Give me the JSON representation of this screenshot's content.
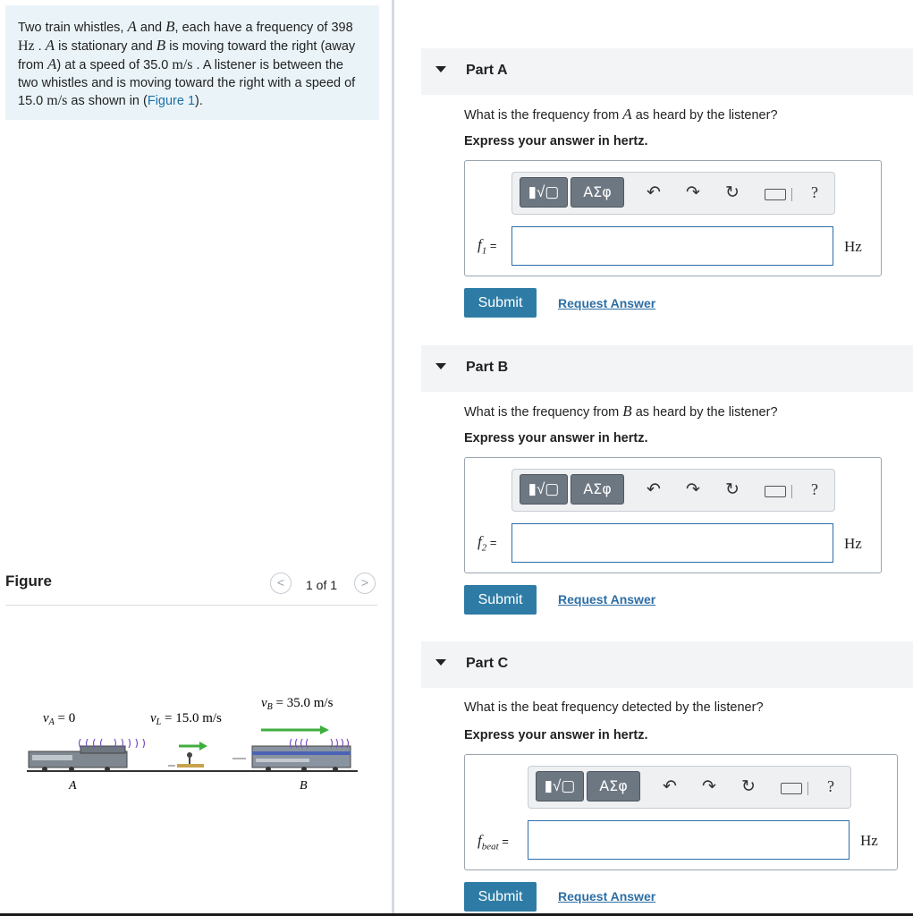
{
  "problem": {
    "seg1": "Two train whistles, ",
    "A": "A",
    "seg2": " and ",
    "B": "B",
    "seg3": ", each have a frequency of 398 ",
    "hz": "Hz",
    "seg4": " . ",
    "seg5": " is stationary and ",
    "seg6": " is moving toward the right (away from ",
    "seg7": ") at a speed of 35.0 ",
    "ms": "m/s",
    "seg8": " . A listener is between the two whistles and is moving toward the right with a speed of 15.0 ",
    "seg9": " as shown in (",
    "figure_link": "Figure 1",
    "seg10": ")."
  },
  "figure": {
    "title": "Figure",
    "pager": "1 of 1",
    "prev": "<",
    "next": ">",
    "labels": {
      "va": "v",
      "va_sub": "A",
      "va_val": " = 0",
      "vl": "v",
      "vl_sub": "L",
      "vl_val": " = 15.0 m/s",
      "vb": "v",
      "vb_sub": "B",
      "vb_val": " = 35.0 m/s",
      "a": "A",
      "b": "B"
    }
  },
  "parts": [
    {
      "title": "Part A",
      "question_pre": "What is the frequency from ",
      "question_var": "A",
      "question_post": " as heard by the listener?",
      "instruction": "Express your answer in hertz.",
      "var": "f",
      "var_sub": "1",
      "eq": " =",
      "unit": "Hz",
      "submit": "Submit",
      "request": "Request Answer"
    },
    {
      "title": "Part B",
      "question_pre": "What is the frequency from ",
      "question_var": "B",
      "question_post": " as heard by the listener?",
      "instruction": "Express your answer in hertz.",
      "var": "f",
      "var_sub": "2",
      "eq": " =",
      "unit": "Hz",
      "submit": "Submit",
      "request": "Request Answer"
    },
    {
      "title": "Part C",
      "question_pre": "What is the beat frequency detected by the listener?",
      "question_var": "",
      "question_post": "",
      "instruction": "Express your answer in hertz.",
      "var": "f",
      "var_sub": "beat",
      "eq": " =",
      "unit": "Hz",
      "submit": "Submit",
      "request": "Request Answer"
    }
  ],
  "toolbar": {
    "template_icon": "templates-icon",
    "greek_label": "ΑΣφ",
    "undo_icon": "undo-icon",
    "redo_icon": "redo-icon",
    "reset_icon": "reset-icon",
    "keyboard_icon": "keyboard-icon",
    "help_label": "?"
  },
  "colors": {
    "accent": "#2e7ca5",
    "link": "#2d6ea5",
    "problem_bg": "#eaf4f8",
    "arrow_green": "#3fae3f"
  }
}
